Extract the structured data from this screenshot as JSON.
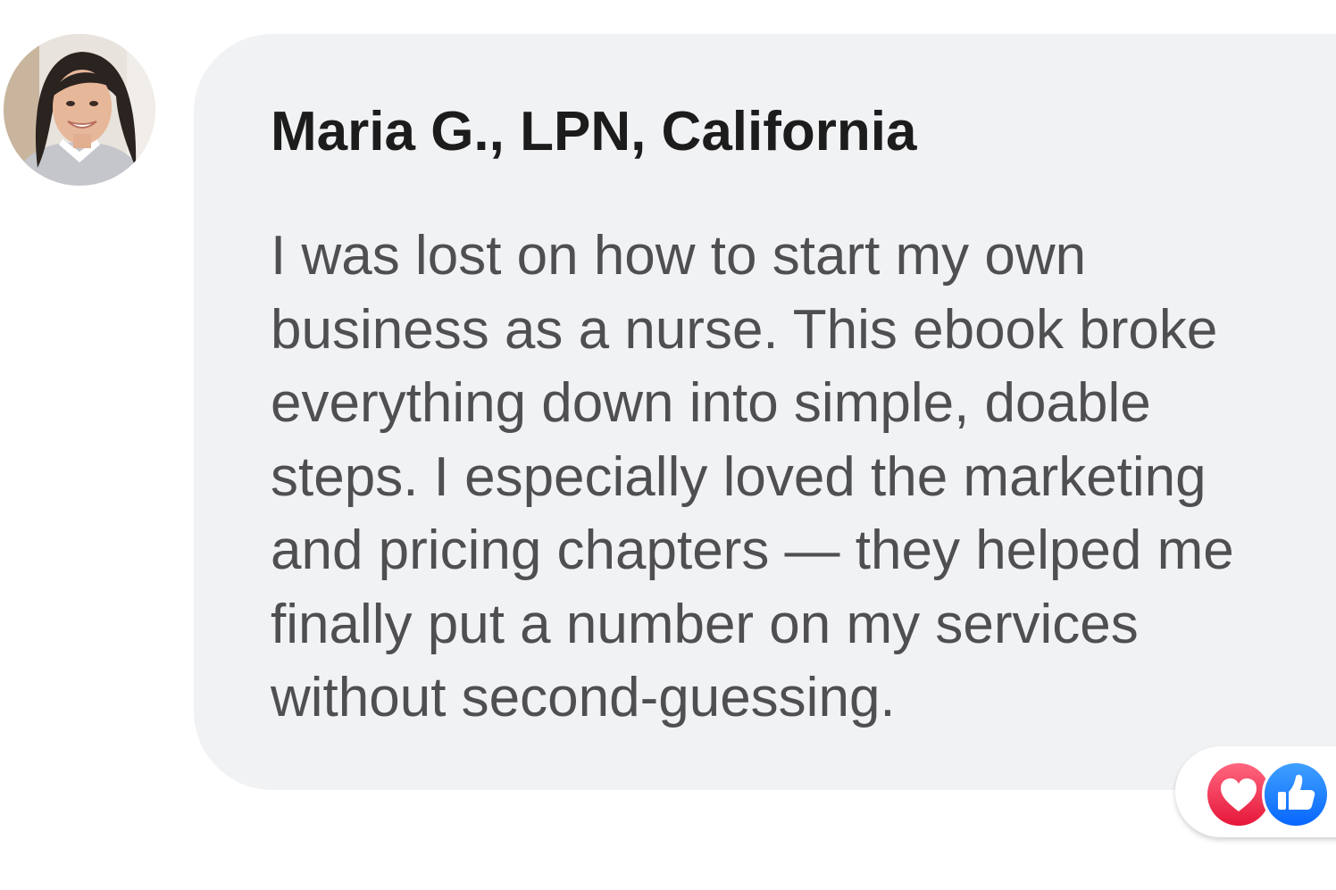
{
  "comment": {
    "author": "Maria G., LPN, California",
    "lines": [
      "I was lost on how to start my own",
      "business as a nurse. This ebook broke",
      "everything down into simple, doable",
      "steps. I especially loved the marketing",
      "and pricing chapters — they helped me",
      "finally put a number on my services",
      "without second-guessing."
    ]
  },
  "avatar": {
    "icon": "user-photo-avatar"
  },
  "reactions": [
    {
      "icon": "love-reaction-icon",
      "color": "#f33e58"
    },
    {
      "icon": "like-reaction-icon",
      "color": "#1877f2"
    }
  ],
  "colors": {
    "bubble": "#f1f2f4",
    "author_text": "#1c1c1c",
    "body_text": "#4f4f52"
  }
}
